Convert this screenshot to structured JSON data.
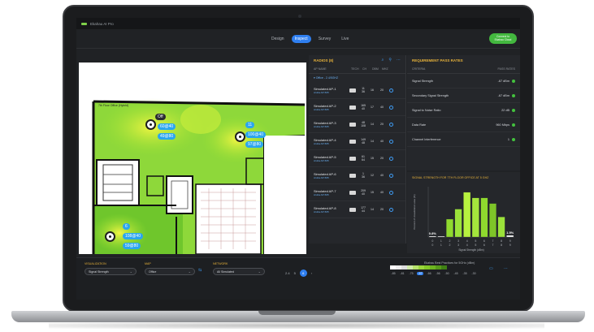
{
  "app": {
    "title": "Ekahau AI Pro"
  },
  "tabs": [
    {
      "label": "Design",
      "active": false
    },
    {
      "label": "Inspect",
      "active": true
    },
    {
      "label": "Survey",
      "active": false
    },
    {
      "label": "Live",
      "active": false
    }
  ],
  "publish": {
    "line1": "Connect to",
    "line2": "Ekahau Cloud"
  },
  "map": {
    "floor_label": "7th Floor Office (Hybrid)",
    "markers": [
      {
        "state": "Off",
        "chip1": "60@40",
        "chip2": "49@80"
      },
      {
        "id": "11",
        "chip1": "100@40",
        "chip2": "97@80"
      },
      {
        "id": "6",
        "chip1": "108@40",
        "chip2": "59@80"
      }
    ]
  },
  "aps_panel": {
    "title": "RADIOS (8)",
    "columns": [
      "AP NAME",
      "TECH",
      "CH",
      "DBM",
      "MHZ"
    ],
    "group": "▾ Office - 2.4/5GHZ",
    "rows": [
      {
        "name": "Simulated AP-1",
        "model": "Aruba AP-505",
        "ch": "11\n36",
        "dbm": "16",
        "mhz": "20"
      },
      {
        "name": "Simulated AP-2",
        "model": "Aruba AP-505",
        "ch": "165\n40",
        "dbm": "17",
        "mhz": "40"
      },
      {
        "name": "Simulated AP-3",
        "model": "Aruba AP-505",
        "ch": "48\n108",
        "dbm": "14",
        "mhz": "20"
      },
      {
        "name": "Simulated AP-4",
        "model": "Aruba AP-505",
        "ch": "149\n48",
        "dbm": "14",
        "mhz": "40"
      },
      {
        "name": "Simulated AP-5",
        "model": "Aruba AP-505",
        "ch": "61\n64",
        "dbm": "15",
        "mhz": "20"
      },
      {
        "name": "Simulated AP-6",
        "model": "Aruba AP-505",
        "ch": "1\n36",
        "dbm": "12",
        "mhz": "40"
      },
      {
        "name": "Simulated AP-7",
        "model": "Aruba AP-505",
        "ch": "209\n40",
        "dbm": "15",
        "mhz": "40"
      },
      {
        "name": "Simulated AP-8",
        "model": "Aruba AP-505",
        "ch": "177\n44",
        "dbm": "14",
        "mhz": "20"
      }
    ]
  },
  "req_panel": {
    "title": "REQUIREMENT PASS RATES",
    "columns": [
      "CRITERIA",
      "PASS RATES"
    ],
    "rows": [
      {
        "label": "Signal Strength",
        "value": "-67 dBm"
      },
      {
        "label": "Secondary Signal Strength",
        "value": "-67 dBm"
      },
      {
        "label": "Signal to Noise Ratio",
        "value": "22 dB"
      },
      {
        "label": "Data Rate",
        "value": "960 Mbps"
      },
      {
        "label": "Channel Interference",
        "value": "1"
      }
    ]
  },
  "chart_data": {
    "type": "bar",
    "title": "SIGNAL STRENGTH FOR 7TH FLOOR OFFICE AT 5 GHZ",
    "categories": [
      "0",
      "1",
      "2",
      "3",
      "4",
      "5",
      "6",
      "7",
      "8",
      "9"
    ],
    "values": [
      0.8,
      0.5,
      16,
      25,
      40,
      35,
      35,
      30,
      18,
      1.5
    ],
    "data_labels": [
      "0.8%",
      "",
      "",
      "",
      "",
      "",
      "",
      "",
      "",
      "1.5%"
    ],
    "ylabel": "Percent of visualization area (%)",
    "xlabel": "Signal Strength (dBm)",
    "colors": [
      "#ffffff",
      "#ffffff",
      "#8fd92e",
      "#9be23a",
      "#b7f23f",
      "#a4e53c",
      "#8fd92e",
      "#7ec528",
      "#9be23a",
      "#ffffff"
    ]
  },
  "bottom": {
    "visualization_label": "VISUALIZATION",
    "visualization_value": "Signal Strength",
    "map_label": "MAP",
    "map_value": "Office",
    "network_label": "NETWORK",
    "network_value": "All Simulated",
    "pager": {
      "prev": "2.4",
      "mid": "5",
      "active": "6"
    },
    "legend_title": "Ekahau Best Practices for 5GHz (dBm)",
    "legend_ticks": [
      "-85",
      "-81",
      "-75",
      "-67",
      "-66",
      "-56",
      "-50",
      "-45",
      "-35",
      "-30"
    ],
    "legend_selected": "-67"
  }
}
